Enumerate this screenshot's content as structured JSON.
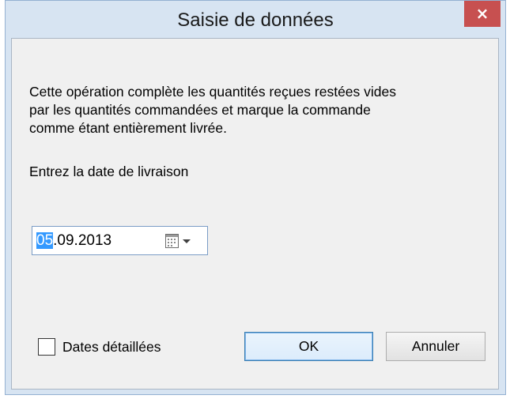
{
  "window": {
    "title": "Saisie de données",
    "close_label": "×"
  },
  "dialog": {
    "description_lines": [
      "Cette opération complète les quantités reçues restées vides",
      "par les quantités commandées et marque la commande",
      "comme étant entièrement livrée."
    ],
    "prompt": "Entrez la date de livraison"
  },
  "date_picker": {
    "day": "05",
    "rest": ".09.2013",
    "value": "05.09.2013"
  },
  "options": {
    "detailed_dates_label": "Dates détaillées",
    "detailed_dates_checked": false
  },
  "buttons": {
    "ok_label": "OK",
    "cancel_label": "Annuler"
  },
  "colors": {
    "frame": "#d7e4f2",
    "close_button": "#c75050",
    "selection": "#3399ff",
    "client": "#f0f0f0"
  },
  "icons": {
    "calendar": "calendar-icon",
    "dropdown": "chevron-down-icon",
    "close": "close-icon"
  }
}
